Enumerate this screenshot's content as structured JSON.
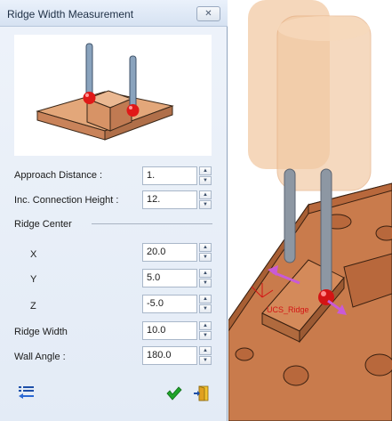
{
  "dialog": {
    "title": "Ridge Width Measurement",
    "close_glyph": "✕",
    "preview_image": "ridge-width-probe-illustration",
    "fields": {
      "approach_distance": {
        "label": "Approach Distance :",
        "value": "1."
      },
      "inc_connection_height": {
        "label": "Inc. Connection Height :",
        "value": "12."
      },
      "ridge_center": {
        "label": "Ridge Center"
      },
      "x": {
        "label": "X",
        "value": "20.0"
      },
      "y": {
        "label": "Y",
        "value": "5.0"
      },
      "z": {
        "label": "Z",
        "value": "-5.0"
      },
      "ridge_width": {
        "label": "Ridge Width",
        "value": "10.0"
      },
      "wall_angle": {
        "label": "Wall Angle :",
        "value": "180.0"
      }
    },
    "spinner": {
      "up_glyph": "▲",
      "down_glyph": "▼"
    },
    "footer_icons": [
      "options-list-icon",
      "ok-checkmark-icon",
      "exit-door-icon"
    ]
  },
  "viewport": {
    "ucs_label": "UCS_Ridge",
    "colors": {
      "workpiece": "#c97b4c",
      "probe_ghost": "#f2c9a4",
      "probe_shaft": "#8d97a3",
      "ruby_ball": "#d41414",
      "arrow": "#c95ad6",
      "ucs_text": "#d41414"
    }
  }
}
